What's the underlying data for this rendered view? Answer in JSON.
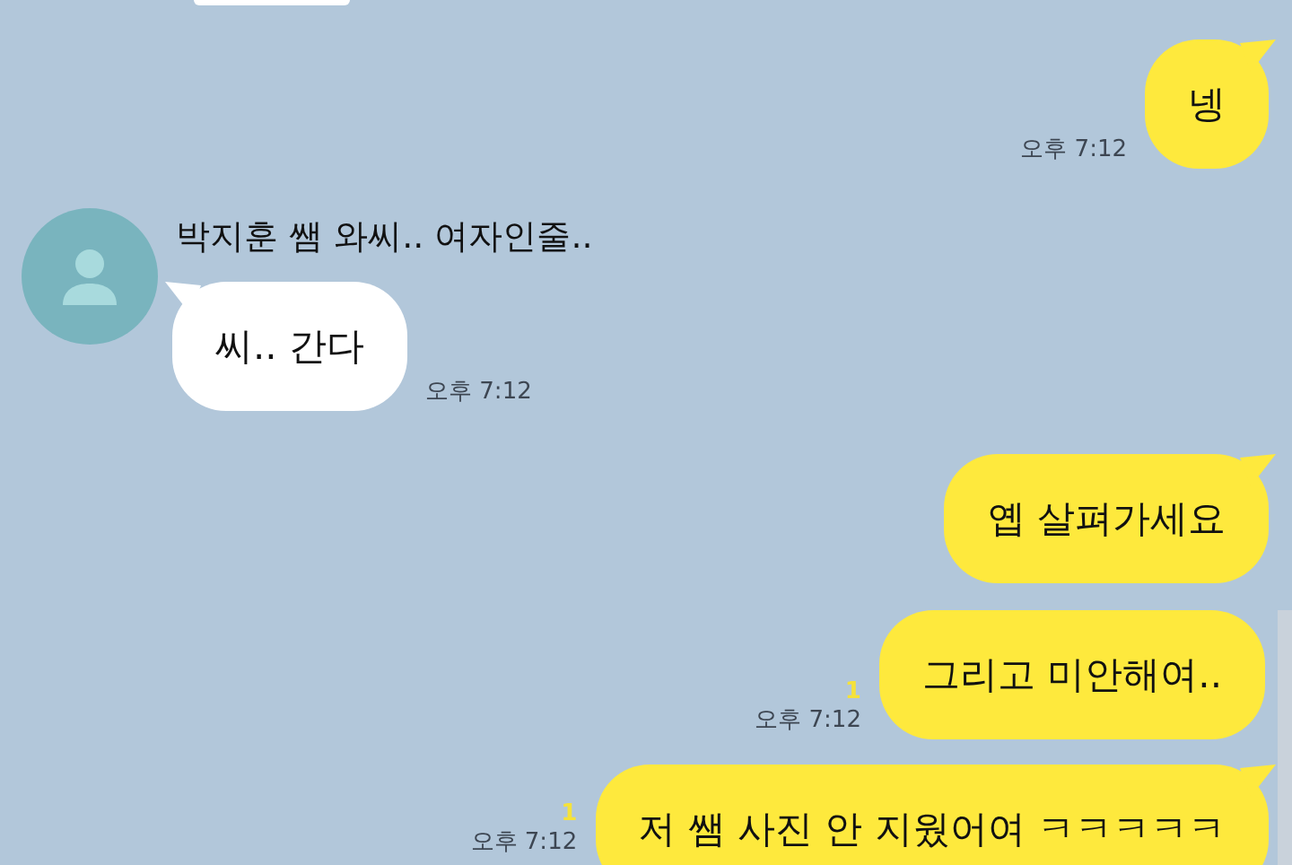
{
  "messages": [
    {
      "kind": "cut",
      "outgoing": false
    },
    {
      "kind": "text",
      "outgoing": true,
      "text": "넹",
      "tail": true,
      "time": "오후 7:12"
    },
    {
      "kind": "text",
      "outgoing": false,
      "sender": "박지훈 쌤 와씨.. 여자인줄..",
      "text": "씨.. 간다",
      "tail": true,
      "time": "오후 7:12"
    },
    {
      "kind": "text",
      "outgoing": true,
      "text": "옙 살펴가세요",
      "tail": true
    },
    {
      "kind": "text",
      "outgoing": true,
      "text": "그리고 미안해여..",
      "tail": false,
      "unread": "1",
      "time": "오후 7:12"
    },
    {
      "kind": "text",
      "outgoing": true,
      "text": "저 쌤 사진 안 지웠어여 ㅋㅋㅋㅋㅋ",
      "tail": true,
      "unread": "1",
      "time": "오후 7:12"
    }
  ]
}
